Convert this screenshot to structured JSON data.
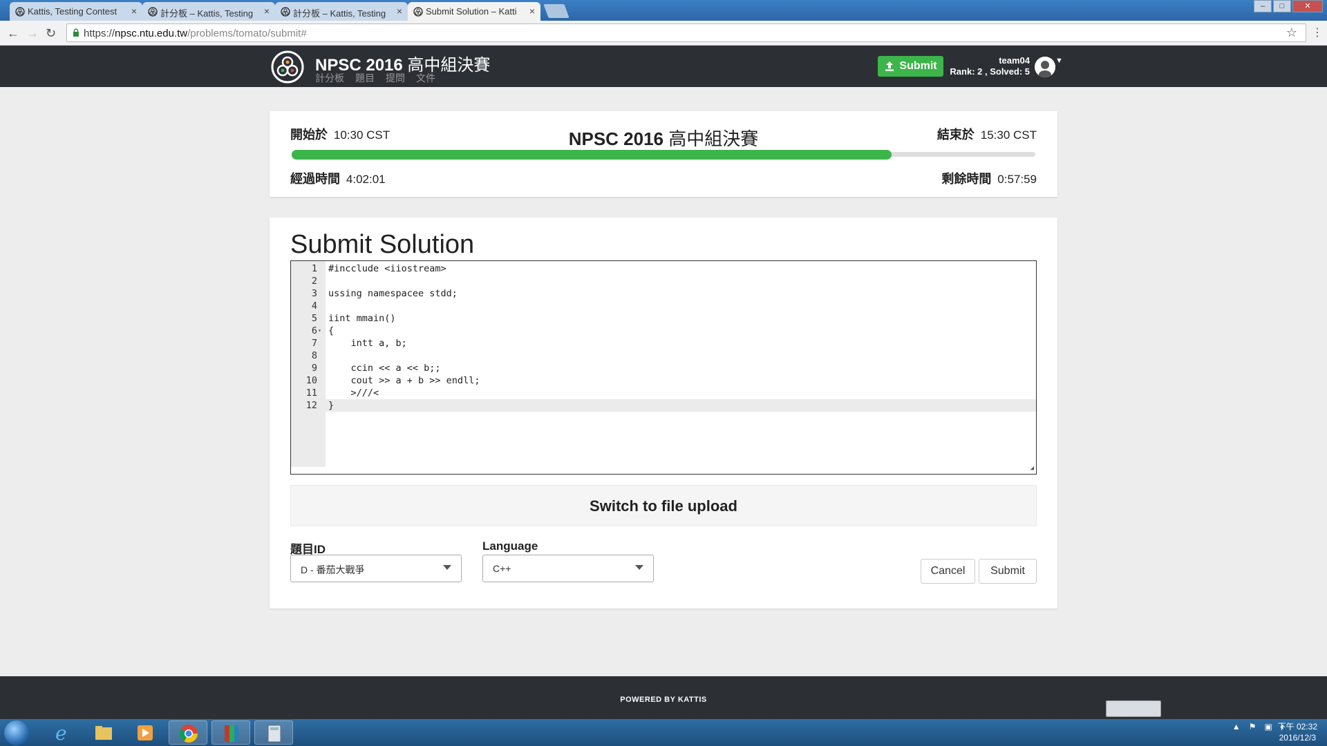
{
  "browser": {
    "tabs": [
      {
        "title": "Kattis, Testing Contest",
        "active": false
      },
      {
        "title": "計分板 – Kattis, Testing",
        "active": false
      },
      {
        "title": "計分板 – Kattis, Testing",
        "active": false
      },
      {
        "title": "Submit Solution – Katti",
        "active": true
      }
    ],
    "close_glyph": "×",
    "url": {
      "scheme": "https://",
      "host": "npsc.ntu.edu.tw",
      "path": "/problems/tomato/submit#"
    }
  },
  "site": {
    "title": "NPSC 2016",
    "title_cn": "高中組決賽",
    "nav": [
      "計分板",
      "題目",
      "提問",
      "文件"
    ],
    "submit_button": "Submit",
    "team_name": "team04",
    "rank_text": "Rank: 2 , Solved: 5"
  },
  "contest": {
    "title": "NPSC 2016",
    "title_cn": "高中組決賽",
    "start_label": "開始於",
    "start_time": "10:30 CST",
    "end_label": "結束於",
    "end_time": "15:30 CST",
    "elapsed_label": "經過時間",
    "elapsed": "4:02:01",
    "remaining_label": "剩餘時間",
    "remaining": "0:57:59",
    "progress": 0.807,
    "progress_color": "#3cb54a"
  },
  "submit": {
    "title": "Submit Solution",
    "code_lines": [
      "#incclude <iiostream>",
      "",
      "ussing namespacee stdd;",
      "",
      "iint mmain()",
      "{",
      "    intt a, b;",
      "",
      "    ccin << a << b;;",
      "    cout >> a + b >> endll;",
      "    >///<",
      "}"
    ],
    "current_line": 12,
    "fold_line": 6,
    "switch_upload": "Switch to file upload",
    "problem_label": "題目ID",
    "problem_value": "D - 番茄大戰爭",
    "language_label": "Language",
    "language_value": "C++",
    "cancel": "Cancel",
    "submit": "Submit"
  },
  "footer": {
    "powered": "POWERED BY KATTIS"
  },
  "taskbar": {
    "clock_time": "下午 02:32",
    "clock_date": "2016/12/3"
  },
  "icons": [
    "kattis-logo-icon",
    "upload-icon",
    "avatar-icon",
    "lock-icon",
    "star-icon",
    "back-icon",
    "forward-icon",
    "reload-icon"
  ]
}
